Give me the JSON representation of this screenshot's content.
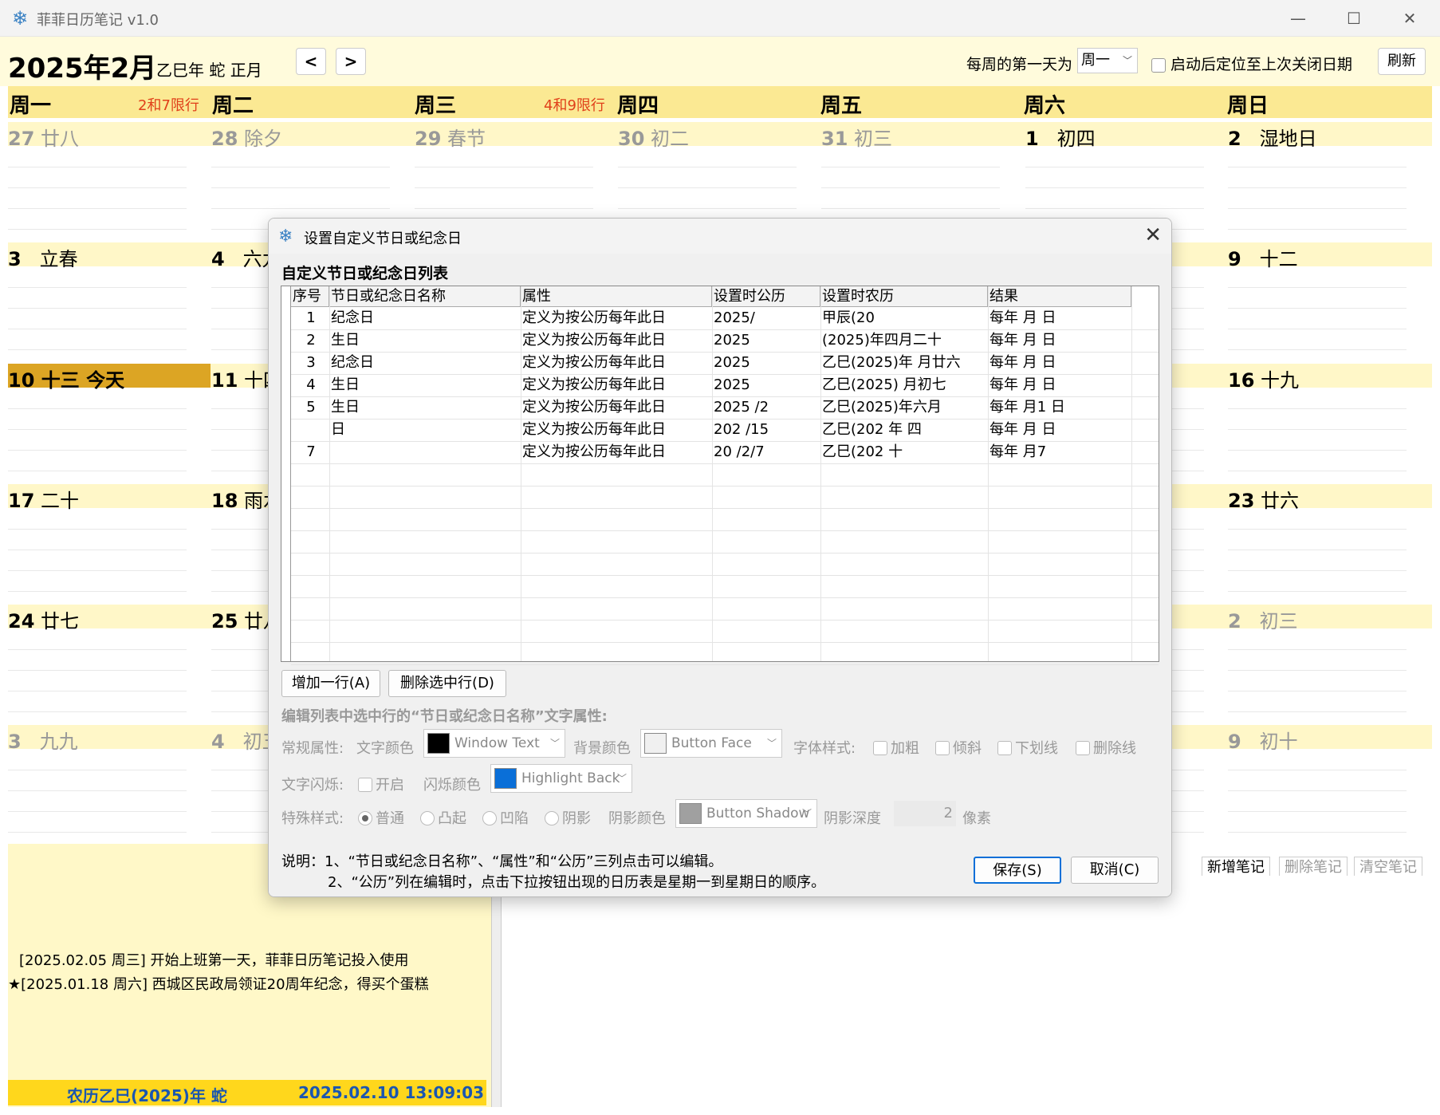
{
  "app": {
    "title": "菲菲日历笔记 v1.0",
    "icon": "snowflake-icon",
    "minimize": "—",
    "maximize": "☐",
    "close": "✕"
  },
  "header": {
    "month": "2025年2月",
    "lunar": "乙巳年 蛇 正月",
    "prev": "<",
    "next": ">",
    "week_start_label": "每周的第一天为",
    "week_start_value": "周一",
    "restore_label": "启动后定位至上次关闭日期",
    "refresh": "刷新"
  },
  "weekdays": [
    "周一",
    "周二",
    "周三",
    "周四",
    "周五",
    "周六",
    "周日"
  ],
  "restrictions": {
    "mon": "2和7限行",
    "wed": "4和9限行"
  },
  "calendar": {
    "row1": [
      {
        "n": "27",
        "t": "廿八",
        "dim": true
      },
      {
        "n": "28",
        "t": "除夕",
        "dim": true
      },
      {
        "n": "29",
        "t": "春节",
        "dim": true
      },
      {
        "n": "30",
        "t": "初二",
        "dim": true
      },
      {
        "n": "31",
        "t": "初三",
        "dim": true
      },
      {
        "n": "1",
        "t": "初四",
        "dim": false
      },
      {
        "n": "2",
        "t": "湿地日",
        "dim": false
      }
    ],
    "row2_mon": {
      "n": "3",
      "t": "立春"
    },
    "row2_tue": {
      "n": "4",
      "t": "六九"
    },
    "row2_sun": {
      "n": "9",
      "t": "十二"
    },
    "row3_mon": {
      "n": "10",
      "t": "十三  今天"
    },
    "row3_tue": {
      "n": "11",
      "t": "十四"
    },
    "row3_sun": {
      "n": "16",
      "t": "十九"
    },
    "row4_mon": {
      "n": "17",
      "t": "二十"
    },
    "row4_tue": {
      "n": "18",
      "t": "雨水"
    },
    "row4_sun": {
      "n": "23",
      "t": "廿六"
    },
    "row5_mon": {
      "n": "24",
      "t": "廿七"
    },
    "row5_tue": {
      "n": "25",
      "t": "廿八"
    },
    "row5_sun": {
      "n": "2",
      "t": "初三"
    },
    "row6_mon": {
      "n": "3",
      "t": "九九"
    },
    "row6_tue": {
      "n": "4",
      "t": "初五"
    },
    "row6_sun": {
      "n": "9",
      "t": "初十"
    }
  },
  "events": [
    "[2025.02.05 周三] 开始上班第一天，菲菲日历笔记投入使用",
    "★[2025.01.18 周六] 西城区民政局领证20周年纪念，得买个蛋糕"
  ],
  "status": {
    "lunar": "农历乙巳(2025)年 蛇",
    "datetime": "2025.02.10 13:09:03"
  },
  "notes": {
    "add": "新增笔记",
    "delete": "删除笔记",
    "clear": "清空笔记"
  },
  "dialog": {
    "title": "设置自定义节日或纪念日",
    "section": "自定义节日或纪念日列表",
    "columns": [
      "序号",
      "节日或纪念日名称",
      "属性",
      "设置时公历",
      "设置时农历",
      "结果"
    ],
    "rows": [
      {
        "no": "1",
        "name": "纪念日",
        "attr": "定义为按公历每年此日",
        "solar": "2025/",
        "lunar": "甲辰(20",
        "result": "每年  月  日"
      },
      {
        "no": "2",
        "name": "生日",
        "attr": "定义为按公历每年此日",
        "solar": "2025",
        "lunar": "(2025)年四月二十",
        "result": "每年  月  日"
      },
      {
        "no": "3",
        "name": "纪念日",
        "attr": "定义为按公历每年此日",
        "solar": "2025",
        "lunar": "乙巳(2025)年  月廿六",
        "result": "每年  月  日"
      },
      {
        "no": "4",
        "name": "生日",
        "attr": "定义为按公历每年此日",
        "solar": "2025",
        "lunar": "乙巳(2025)  月初七",
        "result": "每年  月  日"
      },
      {
        "no": "5",
        "name": "生日",
        "attr": "定义为按公历每年此日",
        "solar": "2025  /2",
        "lunar": "乙巳(2025)年六月",
        "result": "每年  月1  日"
      },
      {
        "no": "",
        "name": "日",
        "attr": "定义为按公历每年此日",
        "solar": "202  /15",
        "lunar": "乙巳(202  年  四",
        "result": "每年  月  日"
      },
      {
        "no": "7",
        "name": "",
        "attr": "定义为按公历每年此日",
        "solar": "20  /2/7",
        "lunar": "乙巳(202  十",
        "result": "每年  月7"
      }
    ],
    "add_row": "增加一行(A)",
    "delete_row": "删除选中行(D)",
    "edit_title": "编辑列表中选中行的“节日或纪念日名称”文字属性:",
    "normal_label": "常规属性:",
    "text_color_label": "文字颜色",
    "text_color": "Window Text",
    "bg_color_label": "背景颜色",
    "bg_color": "Button Face",
    "font_style_label": "字体样式:",
    "bold": "加粗",
    "italic": "倾斜",
    "underline": "下划线",
    "strike": "删除线",
    "blink_label": "文字闪烁:",
    "blink_on": "开启",
    "blink_color_label": "闪烁颜色",
    "blink_color": "Highlight Back",
    "special_label": "特殊样式:",
    "normal": "普通",
    "raised": "凸起",
    "sunken": "凹陷",
    "shadow": "阴影",
    "shadow_color_label": "阴影颜色",
    "shadow_color": "Button Shadow",
    "shadow_depth_label": "阴影深度",
    "shadow_depth": "2",
    "shadow_unit": "像素",
    "note1": "说明：1、“节日或纪念日名称”、“属性”和“公历”三列点击可以编辑。",
    "note2": "2、“公历”列在编辑时，点击下拉按钮出现的日历表是星期一到星期日的顺序。",
    "save": "保存(S)",
    "cancel": "取消(C)"
  },
  "colors": {
    "swatch_text": "#000000",
    "swatch_bg": "#f0f0f0",
    "swatch_blink": "#0a6fd8",
    "swatch_shadow": "#a0a0a0",
    "today": "#dca524",
    "weekbar": "#fbe993"
  }
}
